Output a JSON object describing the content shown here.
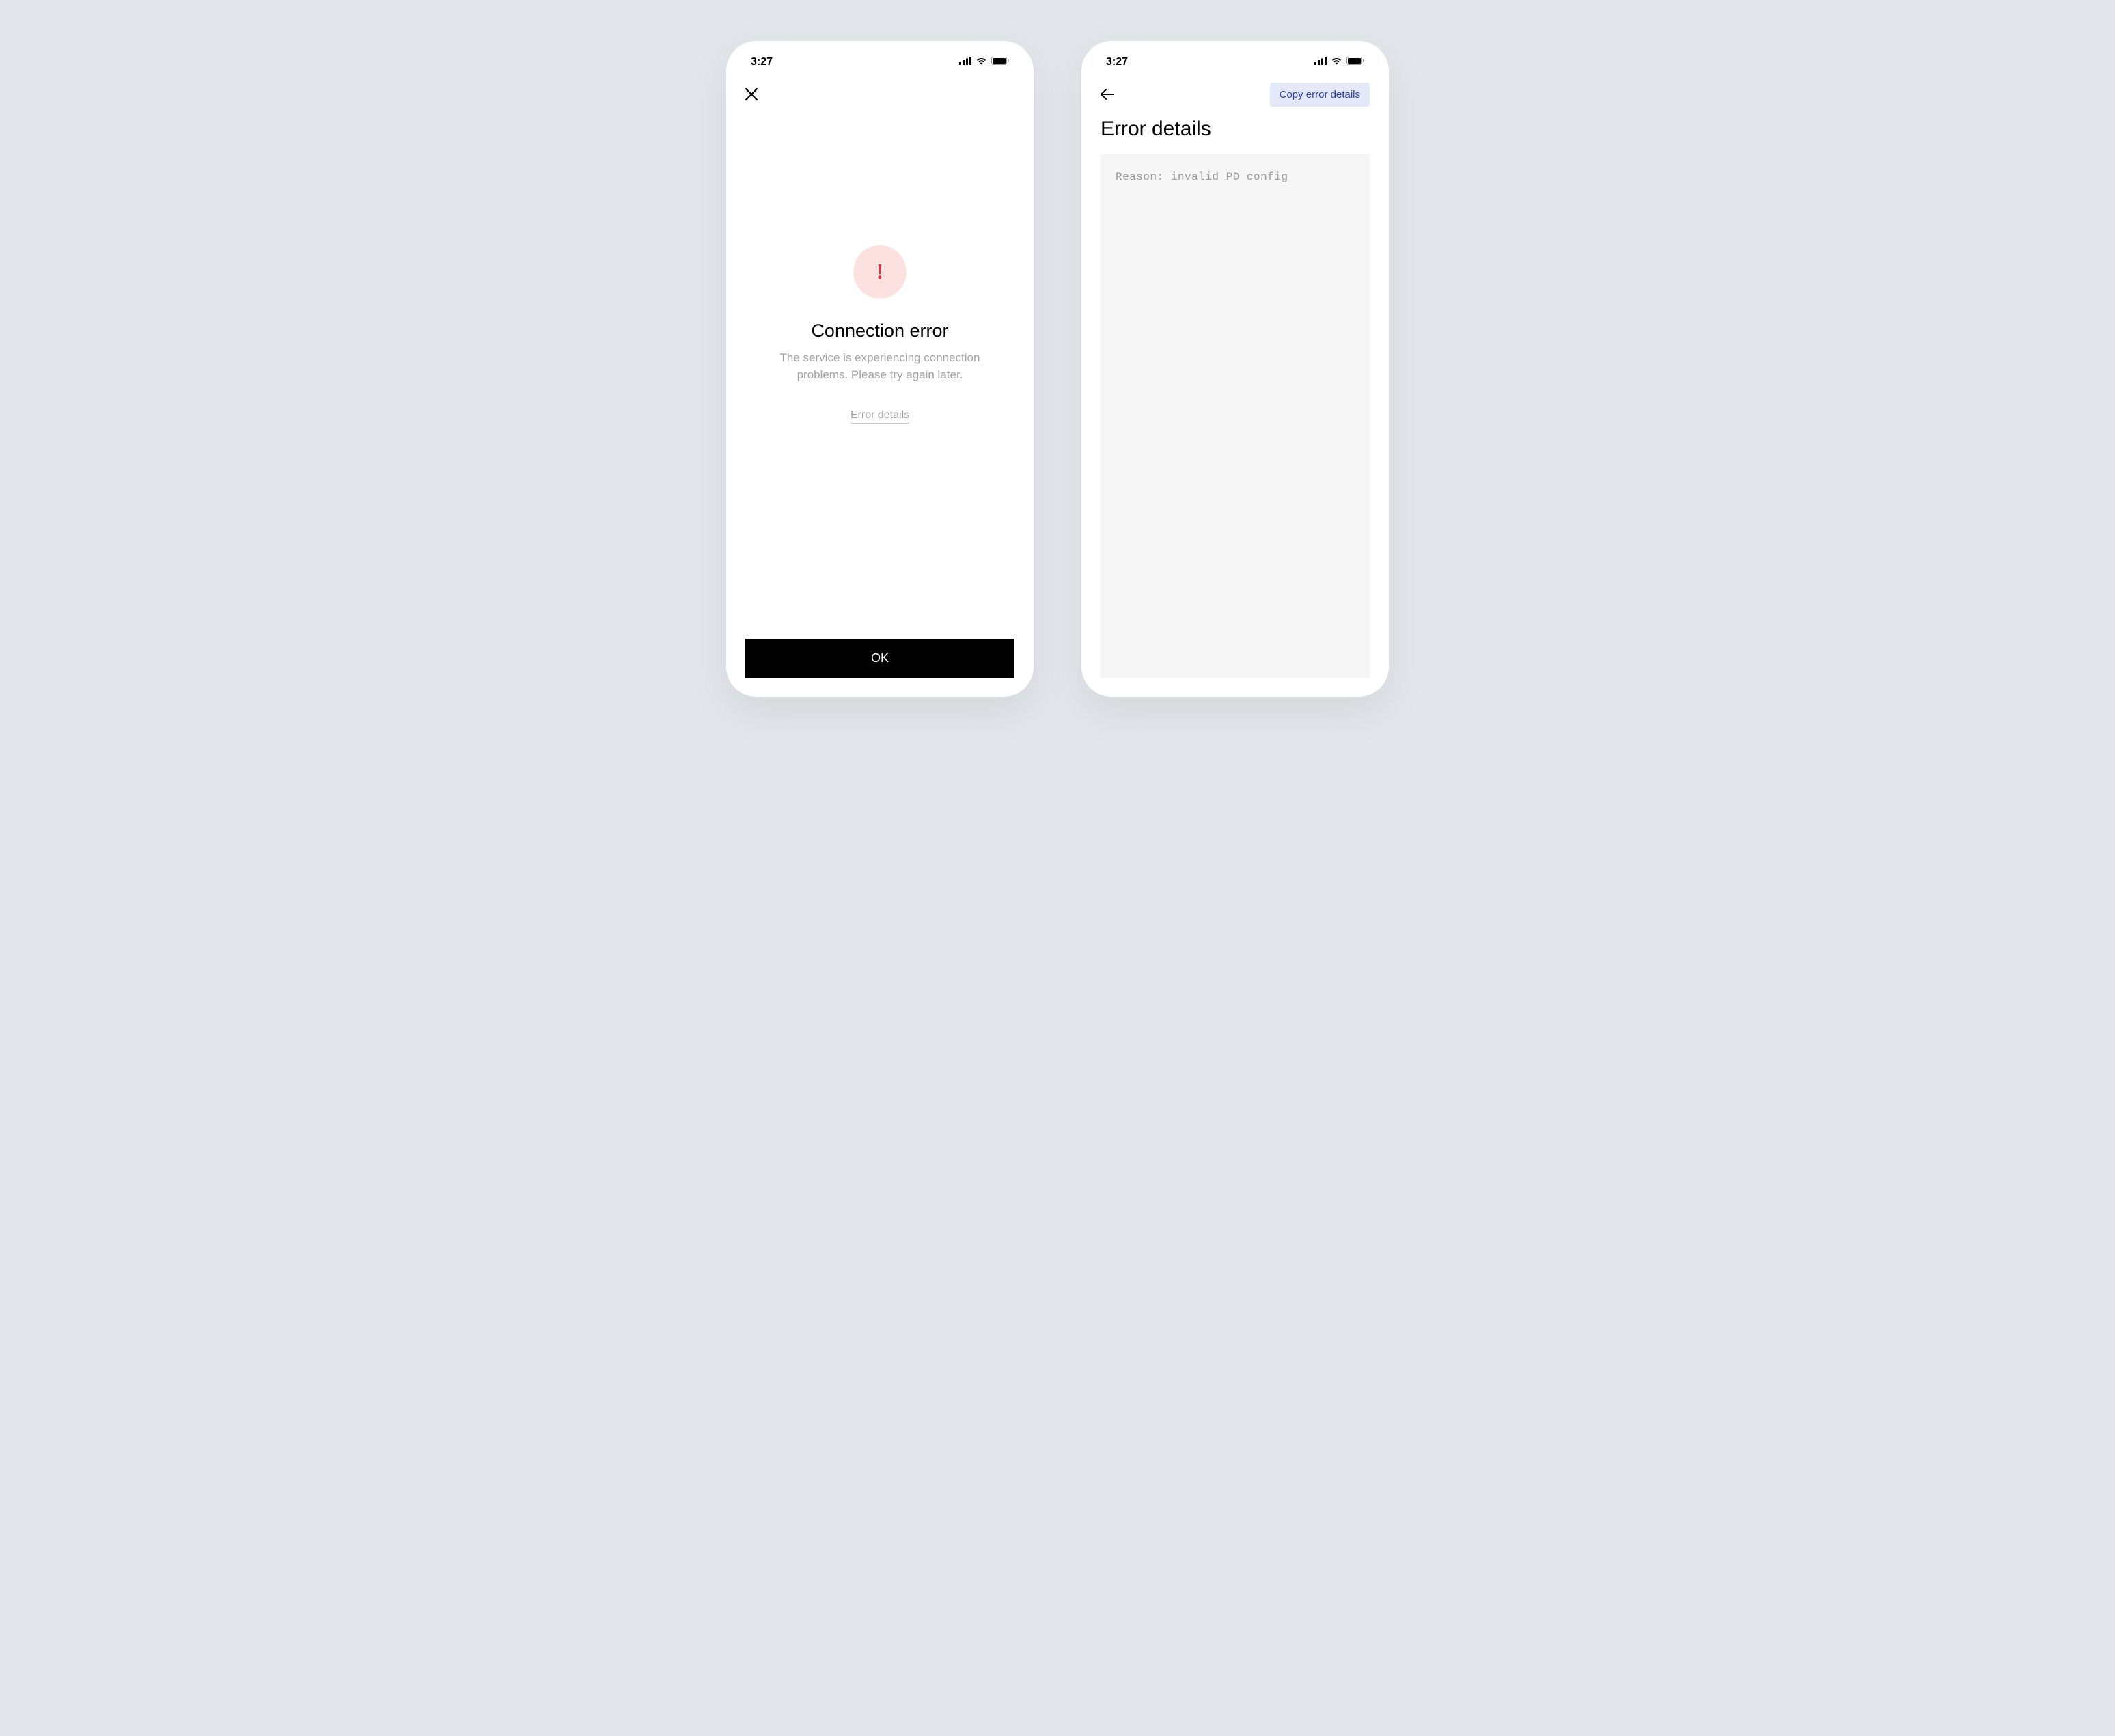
{
  "status_bar": {
    "time": "3:27"
  },
  "screen_error": {
    "icon_name": "exclamation-icon",
    "title": "Connection error",
    "message": "The service is experiencing connection problems. Please try again later.",
    "details_link": "Error details",
    "ok_button": "OK"
  },
  "screen_details": {
    "copy_button": "Copy error details",
    "title": "Error details",
    "reason": "Reason: invalid PD config"
  }
}
